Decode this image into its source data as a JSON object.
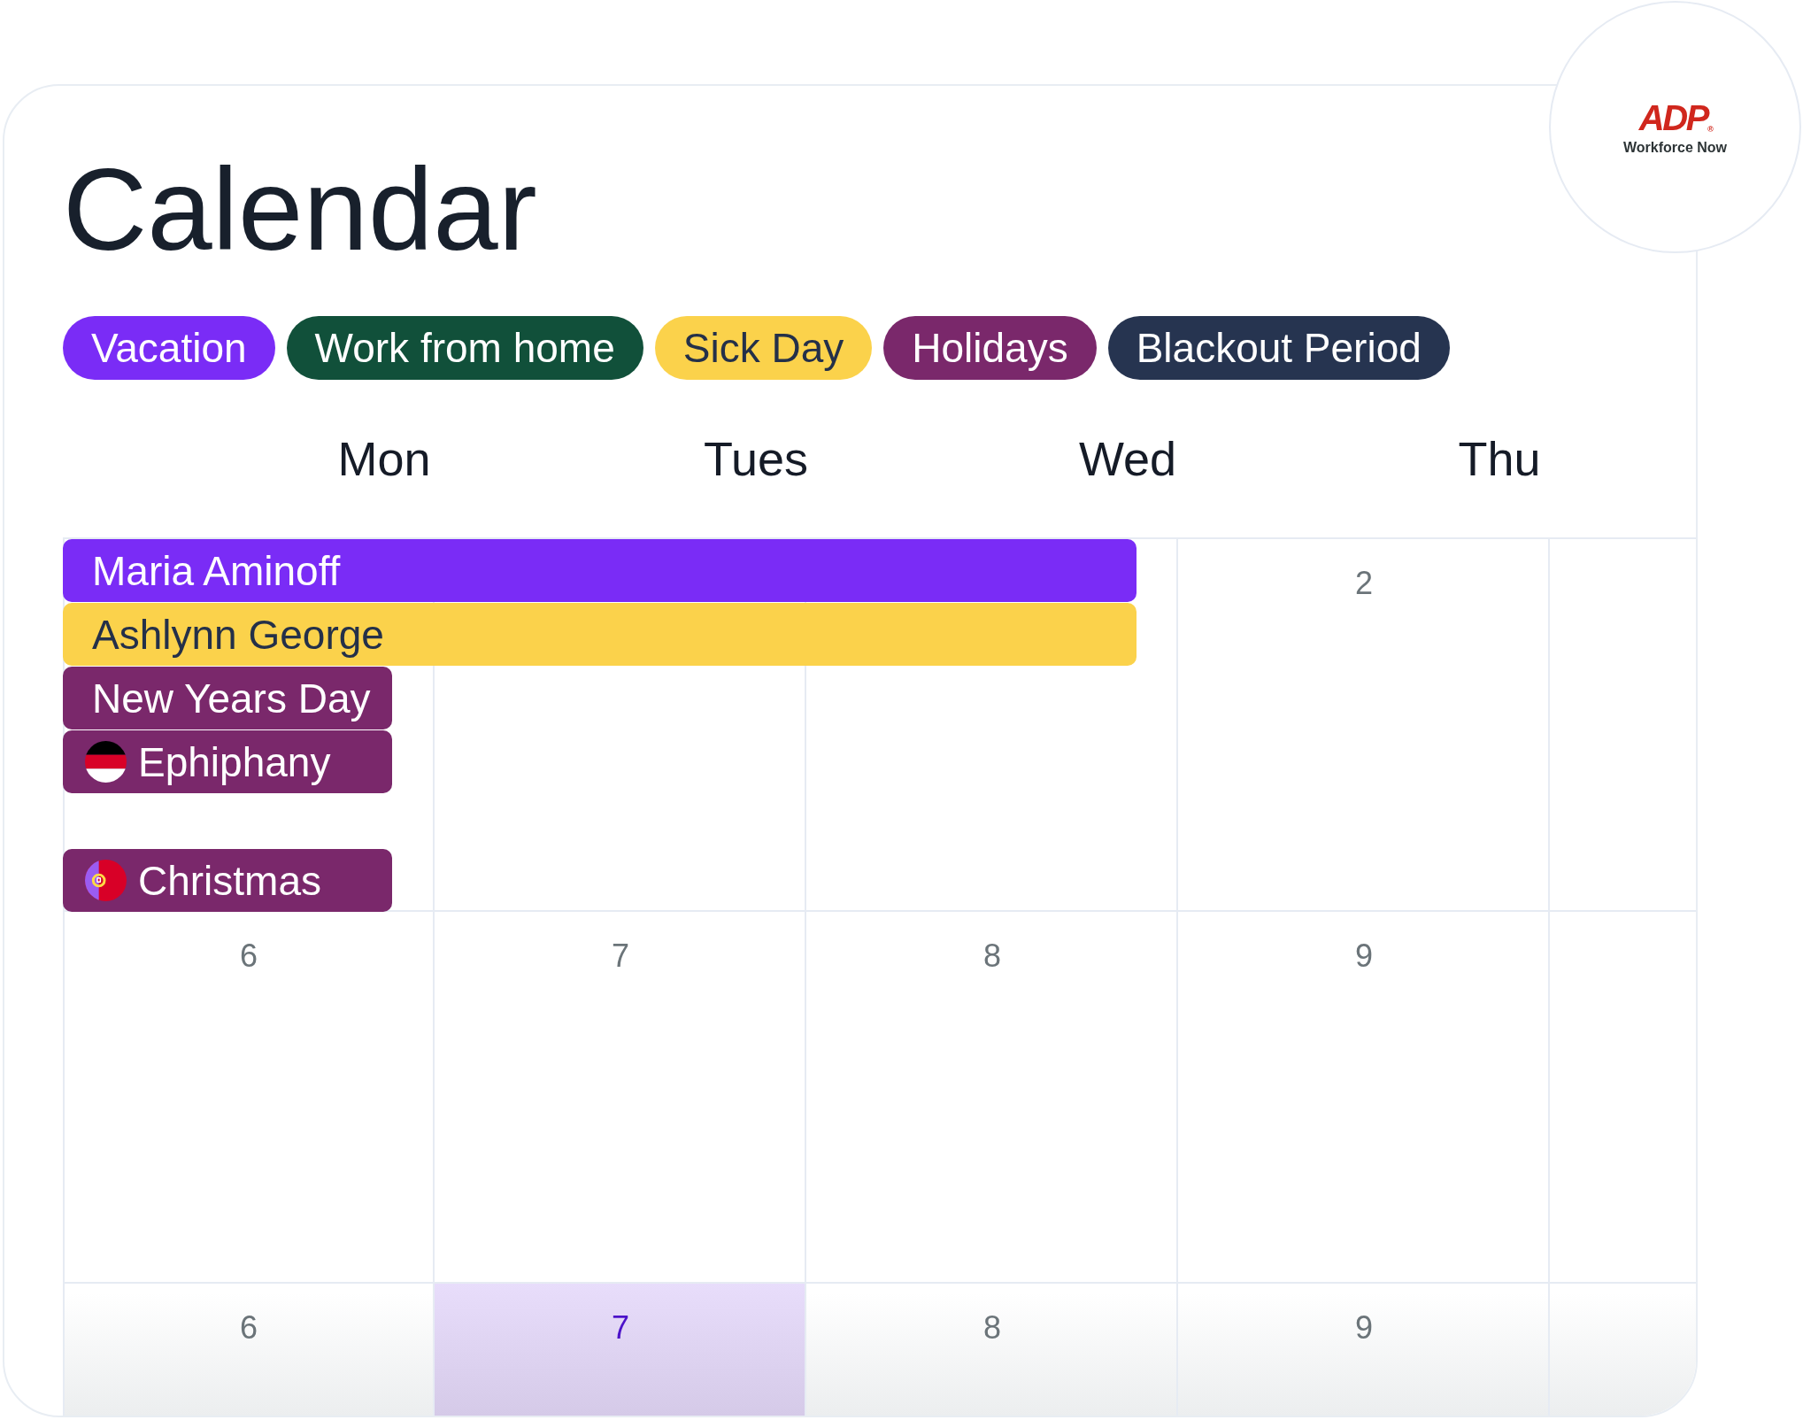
{
  "title": "Calendar",
  "logo": {
    "mark": "ADP$_{®}$",
    "caption": "Workforce Now"
  },
  "legend": [
    {
      "label": "Vacation",
      "color": "#7a2cf6"
    },
    {
      "label": "Work from home",
      "color": "#11503a"
    },
    {
      "label": "Sick Day",
      "color": "#fbd24b"
    },
    {
      "label": "Holidays",
      "color": "#7a286b"
    },
    {
      "label": "Blackout Period",
      "color": "#263450"
    }
  ],
  "weekdays": [
    "Mon",
    "Tues",
    "Wed",
    "Thu"
  ],
  "weeks": [
    {
      "cells": [
        {
          "kind": "blank"
        },
        {
          "kind": "blank"
        },
        {
          "kind": "blank"
        },
        {
          "kind": "day",
          "day": "2",
          "selected": false
        },
        {
          "kind": "blank"
        }
      ],
      "events": [
        {
          "label": "Maria Aminoff",
          "kind": "multi-day",
          "color": "#7a2cf6",
          "flag": false
        },
        {
          "label": "Ashlynn George",
          "kind": "multi-day",
          "color": "#fbd24b",
          "flag": false
        },
        {
          "label": "New Years Day",
          "kind": "single-day",
          "color": "#7a286b",
          "flag": false
        },
        {
          "label": "Ephiphany",
          "kind": "single-day",
          "color": "#7a286b",
          "flag": true
        }
      ],
      "bottom_events": [
        {
          "label": "Christmas",
          "kind": "single-day",
          "color": "#7a286b",
          "flag": true
        }
      ]
    },
    {
      "cells": [
        {
          "kind": "day",
          "day": "6",
          "selected": false
        },
        {
          "kind": "day",
          "day": "7",
          "selected": false
        },
        {
          "kind": "day",
          "day": "8",
          "selected": false
        },
        {
          "kind": "day",
          "day": "9",
          "selected": false
        },
        {
          "kind": "blank"
        }
      ]
    },
    {
      "cells": [
        {
          "kind": "day",
          "day": "6",
          "selected": false
        },
        {
          "kind": "day",
          "day": "7",
          "selected": true
        },
        {
          "kind": "day",
          "day": "8",
          "selected": false
        },
        {
          "kind": "day",
          "day": "9",
          "selected": false
        },
        {
          "kind": "blank"
        }
      ]
    }
  ]
}
